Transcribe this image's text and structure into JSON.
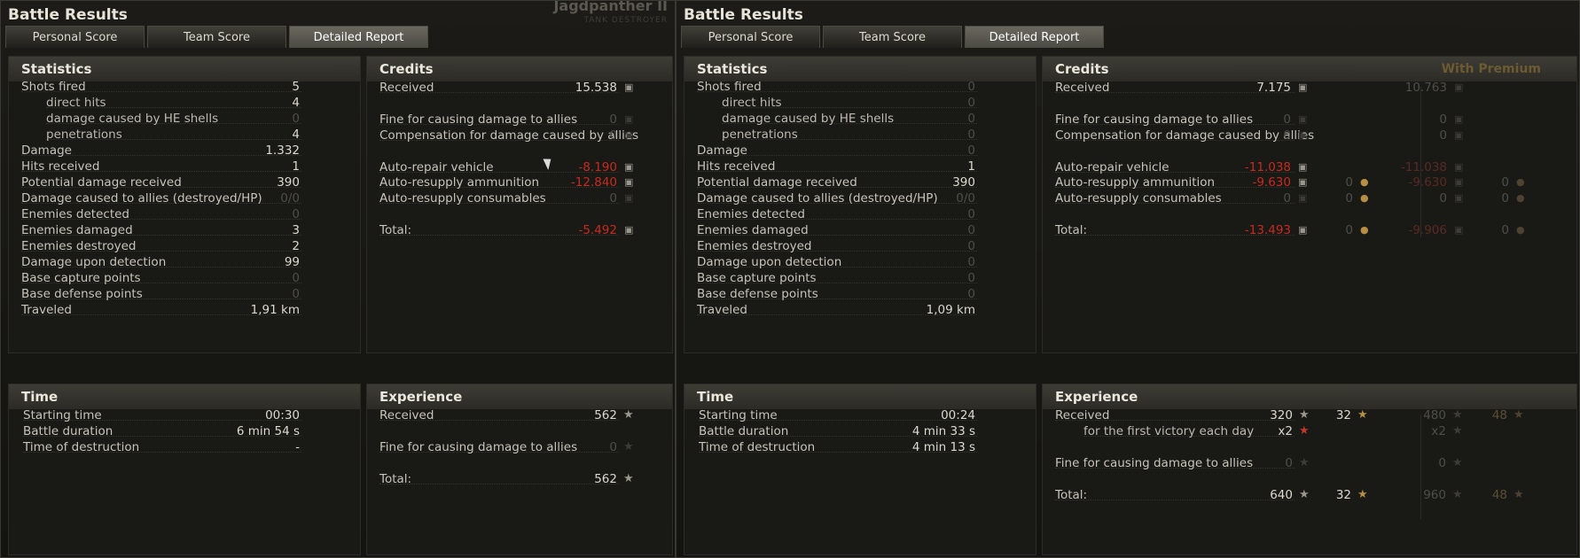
{
  "left": {
    "ghost_title": "Jagdpanther II",
    "ghost_sub": "TANK DESTROYER",
    "title": "Battle Results",
    "tabs": [
      "Personal Score",
      "Team Score",
      "Detailed Report"
    ],
    "active_tab": "Detailed Report",
    "statistics": {
      "heading": "Statistics",
      "rows": [
        {
          "label": "Shots fired",
          "value": "5"
        },
        {
          "label": "direct hits",
          "value": "4",
          "indent": true
        },
        {
          "label": "damage caused by HE shells",
          "value": "0",
          "indent": true,
          "dim": true
        },
        {
          "label": "penetrations",
          "value": "4",
          "indent": true
        },
        {
          "label": "Damage",
          "value": "1.332"
        },
        {
          "label": "Hits received",
          "value": "1"
        },
        {
          "label": "Potential damage received",
          "value": "390"
        },
        {
          "label": "Damage caused to allies (destroyed/HP)",
          "value": "0/0",
          "dim": true
        },
        {
          "label": "Enemies detected",
          "value": "0",
          "dim": true
        },
        {
          "label": "Enemies damaged",
          "value": "3"
        },
        {
          "label": "Enemies destroyed",
          "value": "2"
        },
        {
          "label": "Damage upon detection",
          "value": "99"
        },
        {
          "label": "Base capture points",
          "value": "0",
          "dim": true
        },
        {
          "label": "Base defense points",
          "value": "0",
          "dim": true
        },
        {
          "label": "Traveled",
          "value": "1,91 km"
        }
      ]
    },
    "credits": {
      "heading": "Credits",
      "rows": [
        {
          "label": "Received",
          "value": "15.538"
        },
        {
          "label": "Fine for causing damage to allies",
          "value": "0",
          "dim": true
        },
        {
          "label": "Compensation for damage caused by allies",
          "value": "0",
          "dim": true
        },
        {
          "label": "Auto-repair vehicle",
          "value": "-8.190",
          "neg": true
        },
        {
          "label": "Auto-resupply ammunition",
          "value": "-12.840",
          "neg": true
        },
        {
          "label": "Auto-resupply consumables",
          "value": "0",
          "dim": true
        },
        {
          "label": "Total:",
          "value": "-5.492",
          "neg": true
        }
      ]
    },
    "time": {
      "heading": "Time",
      "rows": [
        {
          "label": "Starting time",
          "value": "00:30"
        },
        {
          "label": "Battle duration",
          "value": "6 min 54 s"
        },
        {
          "label": "Time of destruction",
          "value": "-"
        }
      ]
    },
    "experience": {
      "heading": "Experience",
      "rows": [
        {
          "label": "Received",
          "value": "562"
        },
        {
          "label": "Fine for causing damage to allies",
          "value": "0",
          "dim": true
        },
        {
          "label": "Total:",
          "value": "562"
        }
      ]
    }
  },
  "right": {
    "title": "Battle Results",
    "tabs": [
      "Personal Score",
      "Team Score",
      "Detailed Report"
    ],
    "active_tab": "Detailed Report",
    "statistics": {
      "heading": "Statistics",
      "rows": [
        {
          "label": "Shots fired",
          "value": "0",
          "dim": true
        },
        {
          "label": "direct hits",
          "value": "0",
          "indent": true,
          "dim": true
        },
        {
          "label": "damage caused by HE shells",
          "value": "0",
          "indent": true,
          "dim": true
        },
        {
          "label": "penetrations",
          "value": "0",
          "indent": true,
          "dim": true
        },
        {
          "label": "Damage",
          "value": "0",
          "dim": true
        },
        {
          "label": "Hits received",
          "value": "1"
        },
        {
          "label": "Potential damage received",
          "value": "390"
        },
        {
          "label": "Damage caused to allies (destroyed/HP)",
          "value": "0/0",
          "dim": true
        },
        {
          "label": "Enemies detected",
          "value": "0",
          "dim": true
        },
        {
          "label": "Enemies damaged",
          "value": "0",
          "dim": true
        },
        {
          "label": "Enemies destroyed",
          "value": "0",
          "dim": true
        },
        {
          "label": "Damage upon detection",
          "value": "0",
          "dim": true
        },
        {
          "label": "Base capture points",
          "value": "0",
          "dim": true
        },
        {
          "label": "Base defense points",
          "value": "0",
          "dim": true
        },
        {
          "label": "Traveled",
          "value": "1,09 km"
        }
      ]
    },
    "credits": {
      "heading": "Credits",
      "premium_label": "With Premium",
      "rows": [
        {
          "label": "Received",
          "value": "7.175",
          "prem": "10.763"
        },
        {
          "label": "Fine for causing damage to allies",
          "value": "0",
          "dim": true,
          "prem": "0"
        },
        {
          "label": "Compensation for damage caused by allies",
          "value": "0",
          "dim": true,
          "prem": "0"
        },
        {
          "label": "Auto-repair vehicle",
          "value": "-11.038",
          "neg": true,
          "prem": "-11.038"
        },
        {
          "label": "Auto-resupply ammunition",
          "value": "-9.630",
          "neg": true,
          "gold": "0",
          "prem": "-9.630",
          "prem_gold": "0"
        },
        {
          "label": "Auto-resupply consumables",
          "value": "0",
          "dim": true,
          "gold": "0",
          "prem": "0",
          "prem_gold": "0"
        },
        {
          "label": "Total:",
          "value": "-13.493",
          "neg": true,
          "gold": "0",
          "prem": "-9.906",
          "prem_gold": "0"
        }
      ]
    },
    "time": {
      "heading": "Time",
      "rows": [
        {
          "label": "Starting time",
          "value": "00:24"
        },
        {
          "label": "Battle duration",
          "value": "4 min 33 s"
        },
        {
          "label": "Time of destruction",
          "value": "4 min 13 s"
        }
      ]
    },
    "experience": {
      "heading": "Experience",
      "rows": [
        {
          "label": "Received",
          "value": "320",
          "free": "32",
          "prem": "480",
          "prem_free": "48"
        },
        {
          "label": "for the first victory each day",
          "value": "x2",
          "indent": true,
          "prem": "x2"
        },
        {
          "label": "Fine for causing damage to allies",
          "value": "0",
          "dim": true,
          "prem": "0"
        },
        {
          "label": "Total:",
          "value": "640",
          "free": "32",
          "prem": "960",
          "prem_free": "48"
        }
      ]
    }
  },
  "icons": {
    "credits": "credits-coin-icon",
    "gold": "gold-coin-icon",
    "experience": "experience-star-icon",
    "free_experience": "free-experience-star-icon"
  },
  "colors": {
    "negative": "#c72b1f",
    "gold": "#b68f45",
    "heading_bg": "#3d3c35"
  }
}
